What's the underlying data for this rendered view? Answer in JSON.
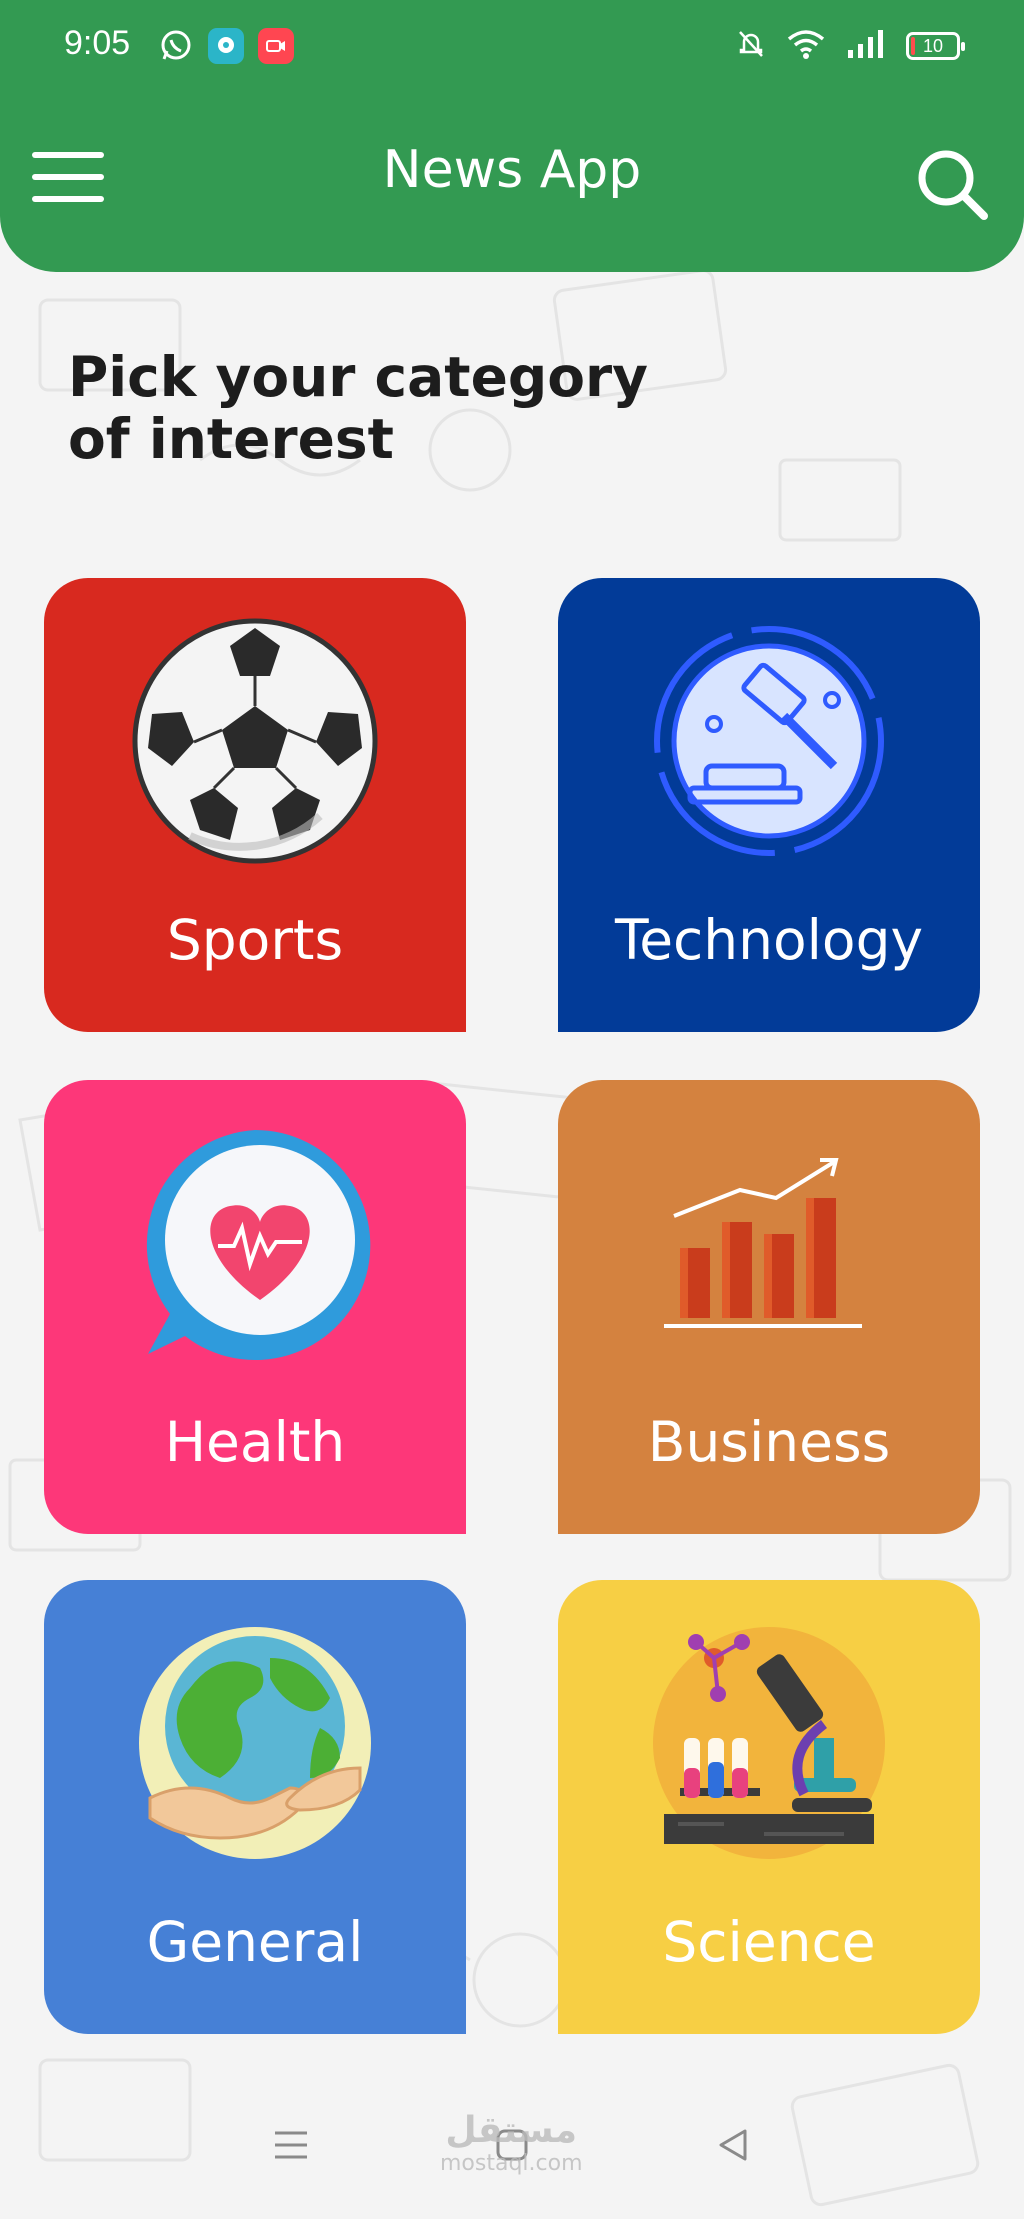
{
  "status_bar": {
    "time": "9:05",
    "battery_level": "10",
    "battery_percent": 10,
    "icons_left": [
      "whatsapp-icon",
      "chat-app-icon",
      "video-recorder-icon"
    ],
    "icons_right": [
      "mute-bell-icon",
      "wifi-icon",
      "signal-icon",
      "battery-icon"
    ]
  },
  "app_bar": {
    "title": "News App",
    "menu_icon": "hamburger-menu-icon",
    "search_icon": "search-icon",
    "color": "#339a52"
  },
  "main": {
    "heading_line1": "Pick your category",
    "heading_line2": "of interest",
    "categories": [
      {
        "label": "Sports",
        "color": "#d8291f",
        "icon": "soccer-ball-icon"
      },
      {
        "label": "Technology",
        "color": "#023b98",
        "icon": "gavel-icon"
      },
      {
        "label": "Health",
        "color": "#fd3779",
        "icon": "heart-chat-icon"
      },
      {
        "label": "Business",
        "color": "#d4823f",
        "icon": "bar-chart-icon"
      },
      {
        "label": "General",
        "color": "#4680d6",
        "icon": "globe-hands-icon"
      },
      {
        "label": "Science",
        "color": "#f7cf44",
        "icon": "microscope-lab-icon"
      }
    ]
  },
  "nav_bar": {
    "buttons": [
      "recent-apps-icon",
      "home-icon",
      "back-icon"
    ]
  },
  "watermark": {
    "arabic": "مستقل",
    "latin": "mostaql.com"
  }
}
